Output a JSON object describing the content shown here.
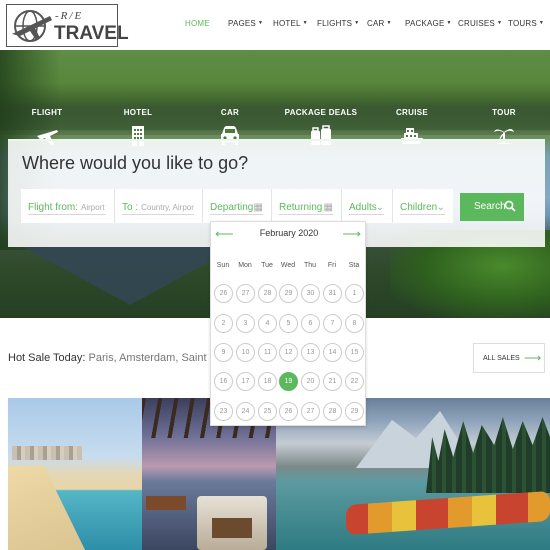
{
  "brand": {
    "line1": "-R/E",
    "line2": "TRAVEL"
  },
  "nav": [
    {
      "label": "HOME",
      "active": true,
      "caret": false
    },
    {
      "label": "PAGES",
      "active": false,
      "caret": true
    },
    {
      "label": "HOTEL",
      "active": false,
      "caret": true
    },
    {
      "label": "FLIGHTS",
      "active": false,
      "caret": true
    },
    {
      "label": "CAR",
      "active": false,
      "caret": true
    },
    {
      "label": "PACKAGE",
      "active": false,
      "caret": true
    },
    {
      "label": "CRUISES",
      "active": false,
      "caret": true
    },
    {
      "label": "TOURS",
      "active": false,
      "caret": true
    }
  ],
  "tabs": [
    {
      "label": "FLIGHT",
      "icon": "airplane-icon"
    },
    {
      "label": "HOTEL",
      "icon": "building-icon"
    },
    {
      "label": "CAR",
      "icon": "car-icon"
    },
    {
      "label": "PACKAGE DEALS",
      "icon": "luggage-icon"
    },
    {
      "label": "CRUISE",
      "icon": "ship-icon"
    },
    {
      "label": "TOUR",
      "icon": "palm-tree-icon"
    }
  ],
  "search": {
    "title": "Where would you like to go?",
    "flight_from": {
      "label": "Flight from:",
      "placeholder": "Airport"
    },
    "to": {
      "label": "To :",
      "placeholder": "Country, Airpor"
    },
    "departing": "Departing",
    "returning": "Returning",
    "adults": "Adults",
    "children": "Children",
    "button": "Search"
  },
  "datepicker": {
    "month": "February 2020",
    "weekdays": [
      "Sun",
      "Mon",
      "Tue",
      "Wed",
      "Thu",
      "Fri",
      "Sta"
    ],
    "weeks": [
      [
        "26",
        "27",
        "28",
        "29",
        "30",
        "31",
        "1"
      ],
      [
        "2",
        "3",
        "4",
        "5",
        "6",
        "7",
        "8"
      ],
      [
        "9",
        "10",
        "11",
        "12",
        "13",
        "14",
        "15"
      ],
      [
        "16",
        "17",
        "18",
        "19",
        "20",
        "21",
        "22"
      ],
      [
        "23",
        "24",
        "25",
        "26",
        "27",
        "28",
        "29"
      ]
    ],
    "selected": "19",
    "accent": "#5cb85c"
  },
  "hot_sale": {
    "label": "Hot Sale Today:",
    "cities": "Paris, Amsterdam, Saint Pe"
  },
  "all_sales": "ALL SALES",
  "colors": {
    "accent": "#5cb85c",
    "text": "#333333"
  }
}
